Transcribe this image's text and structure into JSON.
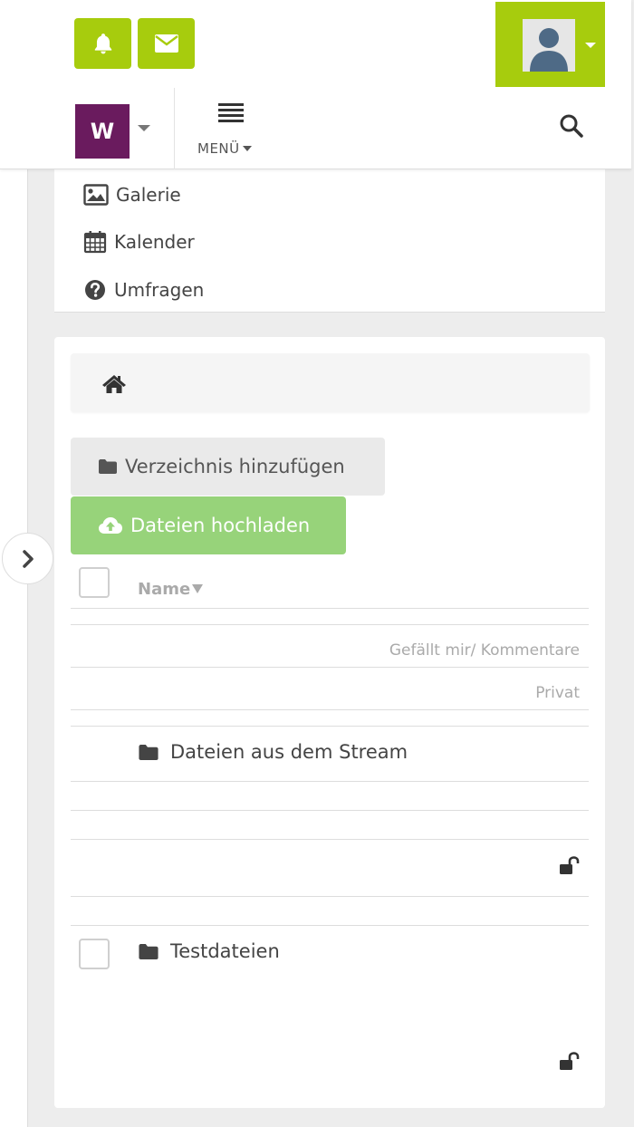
{
  "header": {
    "space_initial": "W",
    "menu_label": "MENÜ",
    "icons": {
      "notifications": "bell-icon",
      "messages": "envelope-icon",
      "profile": "user-avatar-icon",
      "menu": "hamburger-icon",
      "search": "search-icon"
    },
    "colors": {
      "accent": "#a7cc0d",
      "space": "#6a1b5e"
    }
  },
  "nav": {
    "items": [
      {
        "label": "Galerie",
        "icon": "image-icon"
      },
      {
        "label": "Kalender",
        "icon": "calendar-icon"
      },
      {
        "label": "Umfragen",
        "icon": "question-circle-icon"
      }
    ]
  },
  "files": {
    "breadcrumb_icon": "home-icon",
    "add_directory_label": "Verzeichnis hinzufügen",
    "upload_label": "Dateien hochladen",
    "upload_color": "#97d37a",
    "columns": {
      "name": "Name",
      "likes_comments": "Gefällt mir/ Kommentare",
      "private": "Privat"
    },
    "rows": [
      {
        "name": "Dateien aus dem Stream",
        "icon": "folder-icon",
        "lock": "unlocked-icon"
      },
      {
        "name": "Testdateien",
        "icon": "folder-icon",
        "lock": "unlocked-icon"
      }
    ]
  }
}
